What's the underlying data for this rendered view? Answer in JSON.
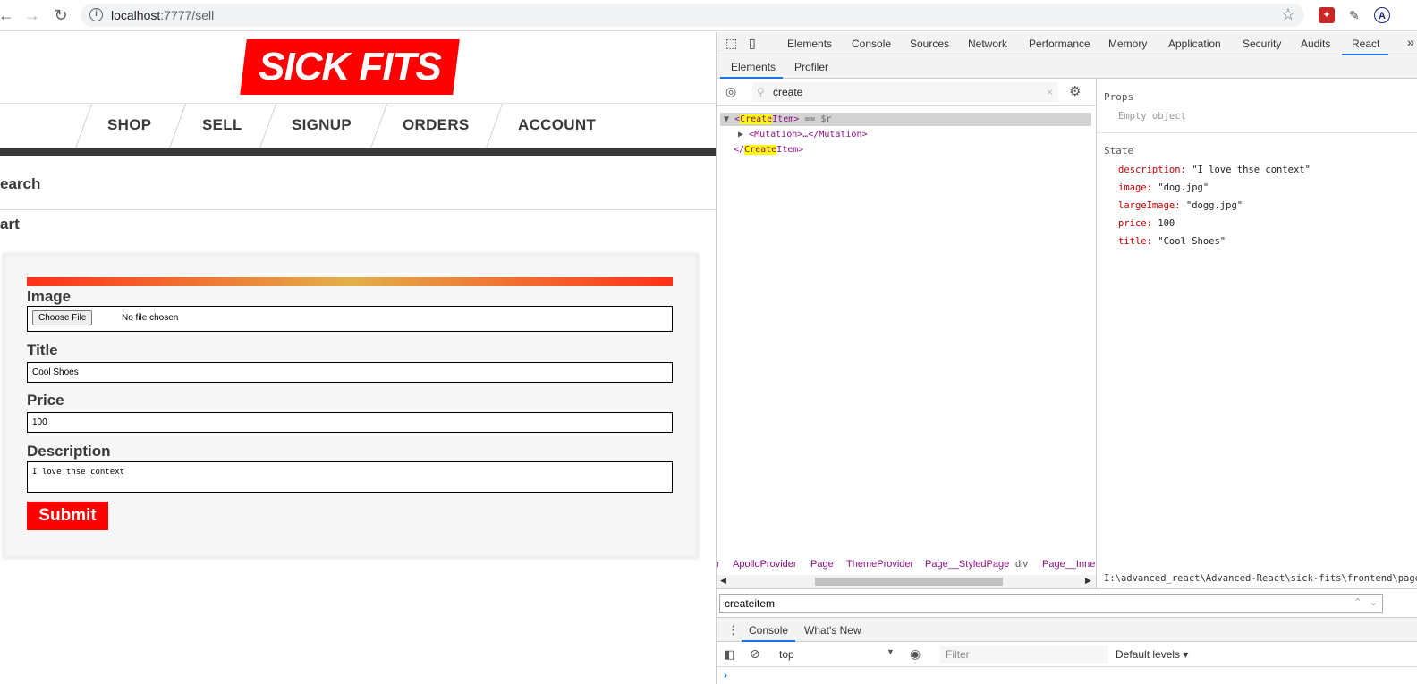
{
  "browser": {
    "url_host": "localhost",
    "url_path": ":7777/sell",
    "back_icon": "arrow-left-icon",
    "forward_icon": "arrow-right-icon",
    "reload_icon": "reload-icon"
  },
  "site": {
    "logo": "SICK FITS",
    "nav": [
      "SHOP",
      "SELL",
      "SIGNUP",
      "ORDERS",
      "ACCOUNT"
    ],
    "side_search": "earch",
    "side_cart": "art"
  },
  "form": {
    "image_label": "Image",
    "choose_file": "Choose File",
    "no_file": "No file chosen",
    "title_label": "Title",
    "title_value": "Cool Shoes",
    "price_label": "Price",
    "price_value": "100",
    "description_label": "Description",
    "description_value": "I love thse context",
    "submit": "Submit"
  },
  "devtools": {
    "tabs": [
      "Elements",
      "Console",
      "Sources",
      "Network",
      "Performance",
      "Memory",
      "Application",
      "Security",
      "Audits",
      "React"
    ],
    "more": "»",
    "subtabs": [
      "Elements",
      "Profiler"
    ],
    "search_value": "create",
    "tree": {
      "line1_open": "<",
      "line1_hl": "Create",
      "line1_rest": "Item>",
      "line1_suffix": " == $r",
      "line2": "<Mutation>…</Mutation>",
      "line3_open": "</",
      "line3_hl": "Create",
      "line3_rest": "Item>"
    },
    "breadcrumbs": [
      "r",
      "ApolloProvider",
      "Page",
      "ThemeProvider",
      "Page__StyledPage",
      "div",
      "Page__Inner"
    ],
    "props_title": "Props",
    "props_empty": "Empty object",
    "state_title": "State",
    "state": [
      {
        "key": "description:",
        "value": "\"I love thse context\""
      },
      {
        "key": "image:",
        "value": "\"dog.jpg\""
      },
      {
        "key": "largeImage:",
        "value": "\"dogg.jpg\""
      },
      {
        "key": "price:",
        "value": "100"
      },
      {
        "key": "title:",
        "value": "\"Cool Shoes\""
      }
    ],
    "path": "I:\\advanced_react\\Advanced-React\\sick-fits\\frontend\\page",
    "find_value": "createitem",
    "drawer_tabs": [
      "Console",
      "What's New"
    ],
    "context": "top",
    "filter_placeholder": "Filter",
    "levels": "Default levels ▾",
    "prompt": "›"
  }
}
